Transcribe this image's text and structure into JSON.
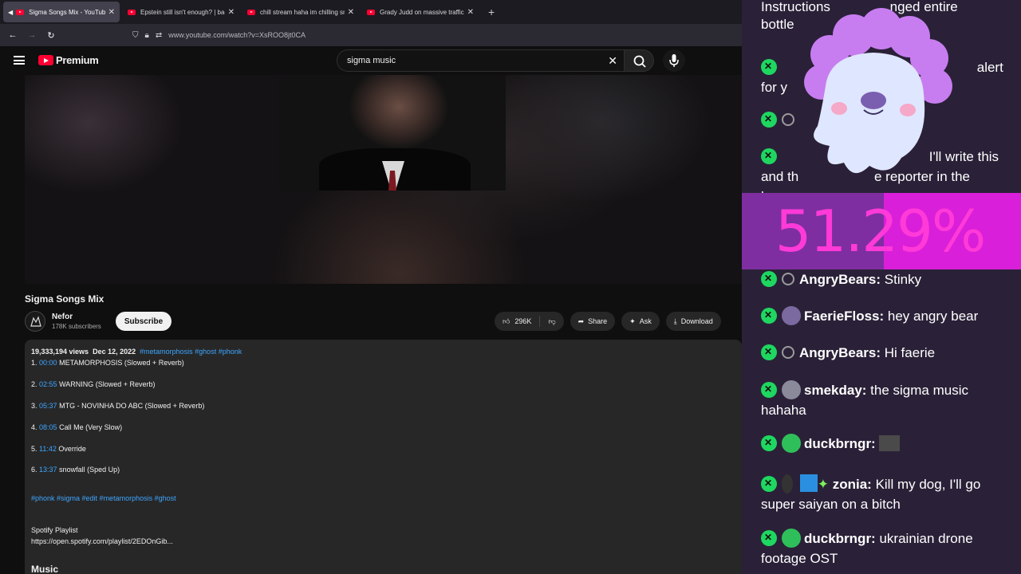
{
  "browser": {
    "tabs": [
      {
        "title": "Sigma Songs Mix - YouTube",
        "active": true,
        "audio": true
      },
      {
        "title": "Epstein still isn't enough? | back",
        "active": false
      },
      {
        "title": "chill stream haha im chilling sm",
        "active": false
      },
      {
        "title": "Grady Judd on massive trafficki",
        "active": false
      }
    ],
    "url": "www.youtube.com/watch?v=XsROO8jt0CA"
  },
  "youtube": {
    "logo_text": "Premium",
    "search_query": "sigma music",
    "video": {
      "title": "Sigma Songs Mix",
      "channel": "Nefor",
      "subscribers": "178K subscribers",
      "subscribe_label": "Subscribe",
      "likes": "296K",
      "share_label": "Share",
      "ask_label": "Ask",
      "download_label": "Download"
    },
    "description": {
      "views": "19,333,194 views",
      "date": "Dec 12, 2022",
      "header_tags": "#metamorphosis #ghost #phonk",
      "tracklist": [
        {
          "n": "1.",
          "time": "00:00",
          "title": "METAMORPHOSIS (Slowed + Reverb)"
        },
        {
          "n": "2.",
          "time": "02:55",
          "title": "WARNING (Slowed + Reverb)"
        },
        {
          "n": "3.",
          "time": "05:37",
          "title": "MTG - NOVINHA DO ABC (Slowed + Reverb)"
        },
        {
          "n": "4.",
          "time": "08:05",
          "title": "Call Me (Very Slow)"
        },
        {
          "n": "5.",
          "time": "11:42",
          "title": "Override"
        },
        {
          "n": "6.",
          "time": "13:37",
          "title": "snowfall (Sped Up)"
        }
      ],
      "tags": "#phonk #sigma #edit #metamorphosis #ghost",
      "spotify_label": "Spotify Playlist",
      "spotify_link": "https://open.spotify.com/playlist/2EDOnGib...",
      "music_heading": "Music"
    }
  },
  "overlay": {
    "percent": "51.29%",
    "percent_value": 51.29,
    "colors": {
      "fill": "#7e2ea0",
      "rest": "#d91fd9",
      "text": "#ff3ad8",
      "badge": "#1ed760"
    },
    "top_fragments": {
      "line1": "Instructions",
      "line1b": "nged entire",
      "line2": "bottle",
      "line3": "alert",
      "line4": "for y",
      "line5": "I'll write this",
      "line6a": "and th",
      "line6b": "e reporter in the",
      "line7": "leg"
    },
    "messages": [
      {
        "user": "AngryBears:",
        "text": "Stinky",
        "icon": "user-icon"
      },
      {
        "user": "FaerieFloss:",
        "text": "hey angry bear",
        "icon": "avatar"
      },
      {
        "user": "AngryBears:",
        "text": "Hi faerie",
        "icon": "user-icon"
      },
      {
        "user": "smekday:",
        "text": "the sigma music hahaha",
        "icon": "avatar"
      },
      {
        "user": "duckbrngr:",
        "text": "",
        "icon": "avatar"
      },
      {
        "user": "zonia:",
        "text": "Kill my dog, I'll go super saiyan on a bitch",
        "icon": "avatar"
      },
      {
        "user": "duckbrngr:",
        "text": "ukrainian drone footage OST",
        "icon": "avatar"
      }
    ]
  }
}
